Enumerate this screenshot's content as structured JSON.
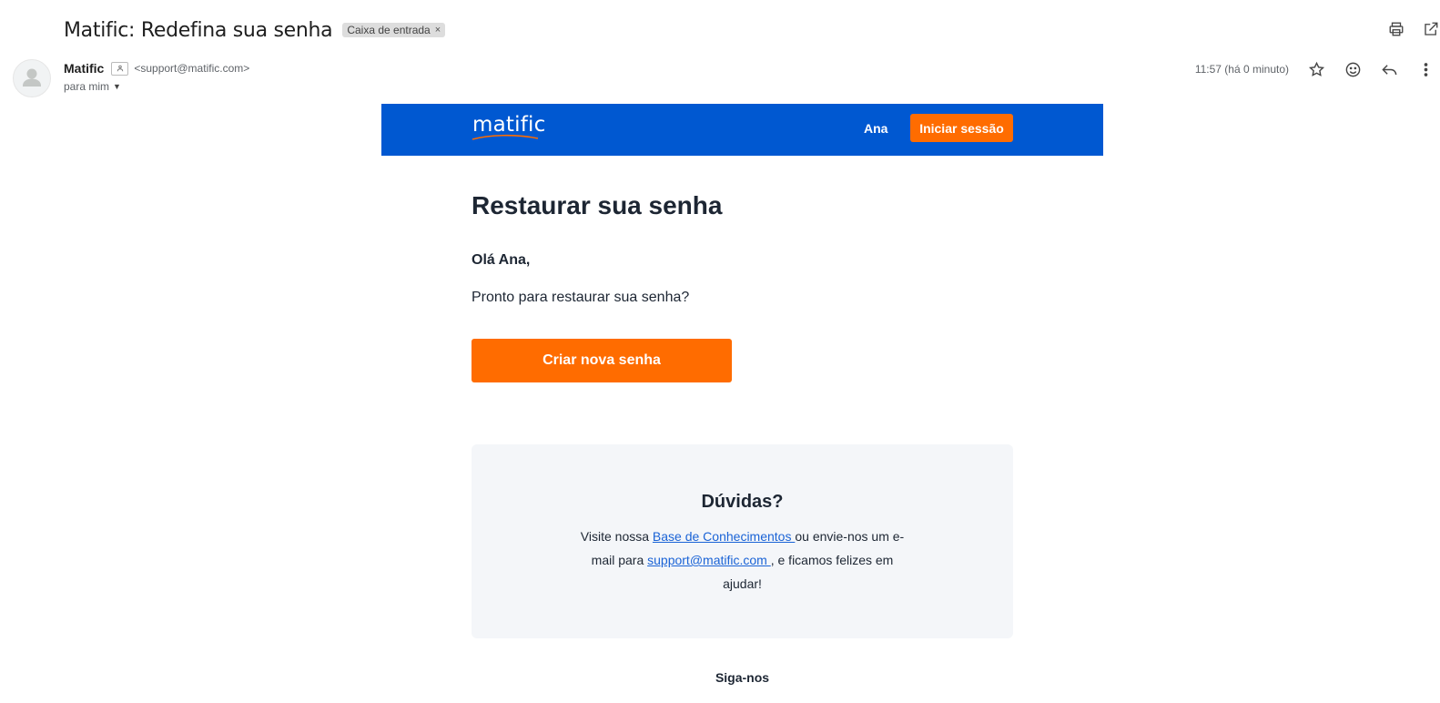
{
  "email": {
    "subject": "Matific: Redefina sua senha",
    "label": "Caixa de entrada",
    "label_remove": "×",
    "sender_name": "Matific",
    "sender_email": "<support@matific.com>",
    "recipient": "para mim",
    "timestamp": "11:57 (há 0 minuto)"
  },
  "icons": {
    "top": [
      "print-icon",
      "open-in-new-window-icon"
    ],
    "meta": [
      "star-icon",
      "emoji-reaction-icon",
      "reply-icon",
      "more-vert-icon"
    ]
  },
  "body": {
    "header": {
      "logo": "matific",
      "user": "Ana",
      "login_button": "Iniciar sessão",
      "brand_color": "#0058d1",
      "accent_color": "#ff6c00"
    },
    "title": "Restaurar sua senha",
    "greeting": "Olá Ana,",
    "prompt": "Pronto para restaurar sua senha?",
    "cta_button": "Criar nova senha",
    "help": {
      "title": "Dúvidas?",
      "text_1": "Visite nossa ",
      "link_kb": "Base de Conhecimentos ",
      "text_2": "ou envie-nos um e-mail para ",
      "link_email": "support@matific.com ",
      "text_3": ", e ficamos felizes em ajudar!"
    },
    "follow": "Siga-nos"
  }
}
